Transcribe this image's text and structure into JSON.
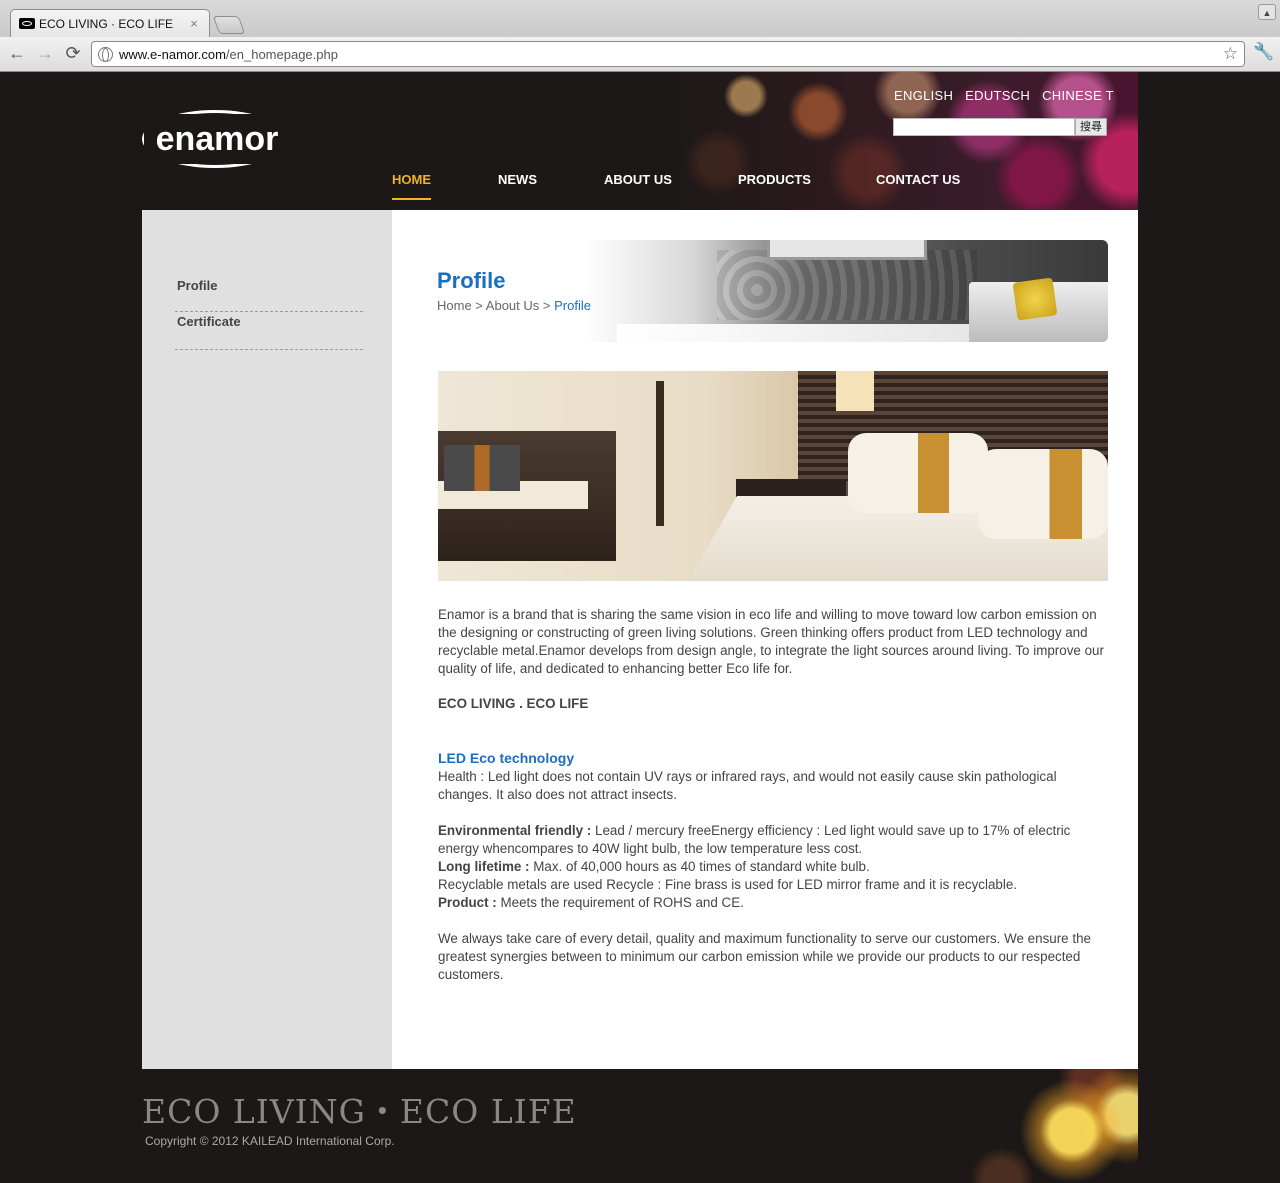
{
  "browser": {
    "tab_title": "ECO LIVING · ECO LIFE",
    "tab_close": "×",
    "url_host": "www.e-namor.com",
    "url_path": "/en_homepage.php",
    "back": "←",
    "forward": "→",
    "reload": "⟳",
    "star": "☆",
    "wrench": "🔧"
  },
  "header": {
    "logo_text": "enamor",
    "languages": [
      "ENGLISH",
      "EDUTSCH",
      "CHINESE T"
    ],
    "search_placeholder": "",
    "search_button": "搜尋",
    "nav": [
      "HOME",
      "NEWS",
      "ABOUT US",
      "PRODUCTS",
      "CONTACT US"
    ],
    "active_nav": "HOME",
    "accent_color": "#f2b41c"
  },
  "sidebar": {
    "items": [
      "Profile",
      "Certificate"
    ]
  },
  "content": {
    "title": "Profile",
    "breadcrumb": {
      "home": "Home",
      "sep1": " > ",
      "about": "About Us",
      "sep2": " > ",
      "current": "Profile"
    },
    "intro": "Enamor is a brand that is sharing the same vision in eco life and willing to move toward low carbon emission on the designing or constructing of green living solutions. Green thinking offers product from LED technology and recyclable metal.Enamor develops from design angle, to integrate the light sources around living. To improve our quality of life, and dedicated to enhancing better Eco life for.",
    "eco_heading": "ECO LIVING . ECO LIFE",
    "led_heading": "LED Eco technology",
    "health": "Health : Led light does not contain UV rays or infrared rays, and would not easily cause skin pathological changes. It also does not attract insects.",
    "env_label": "Environmental friendly :",
    "env_text": " Lead / mercury freeEnergy efficiency : Led light would save up to 17% of electric energy whencompares to 40W light bulb, the low temperature less cost.",
    "life_label": "Long lifetime :",
    "life_text": " Max. of 40,000 hours as 40 times of standard white bulb.",
    "recycle": "Recyclable metals are used Recycle : Fine brass is used for LED mirror frame and it is recyclable.",
    "product_label": "Product :",
    "product_text": " Meets the requirement of ROHS and CE.",
    "closing": "We always take care of every detail, quality and maximum functionality to serve our customers. We ensure the greatest synergies between to minimum our carbon emission while we provide our products to our respected customers.",
    "title_color": "#1a6fc2"
  },
  "footer": {
    "slogan": "ECO LIVING・ECO LIFE",
    "copyright": "Copyright ©  2012 KAILEAD International Corp."
  }
}
